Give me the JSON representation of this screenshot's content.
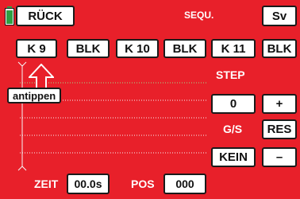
{
  "colors": {
    "background": "#e8202a",
    "button_face": "#ffffff",
    "battery": "#2ea043",
    "dotted_line": "#9be28c",
    "arrow": "#e8202a"
  },
  "header": {
    "back_label": "RÜCK",
    "title": "SEQU.",
    "save_label": "Sv"
  },
  "channels": [
    {
      "label": "K 9"
    },
    {
      "label": "BLK"
    },
    {
      "label": "K 10"
    },
    {
      "label": "BLK"
    },
    {
      "label": "K 11"
    },
    {
      "label": "BLK"
    }
  ],
  "callout": {
    "text": "antippen"
  },
  "right_panel": {
    "step_label": "STEP",
    "step_value": "0",
    "plus_label": "+",
    "gs_label": "G/S",
    "res_label": "RES",
    "kein_label": "KEIN",
    "minus_label": "–"
  },
  "footer": {
    "zeit_label": "ZEIT",
    "zeit_value": "00.0s",
    "pos_label": "POS",
    "pos_value": "000"
  },
  "icons": {
    "battery": "battery-icon",
    "arrow": "up-arrow-icon"
  }
}
